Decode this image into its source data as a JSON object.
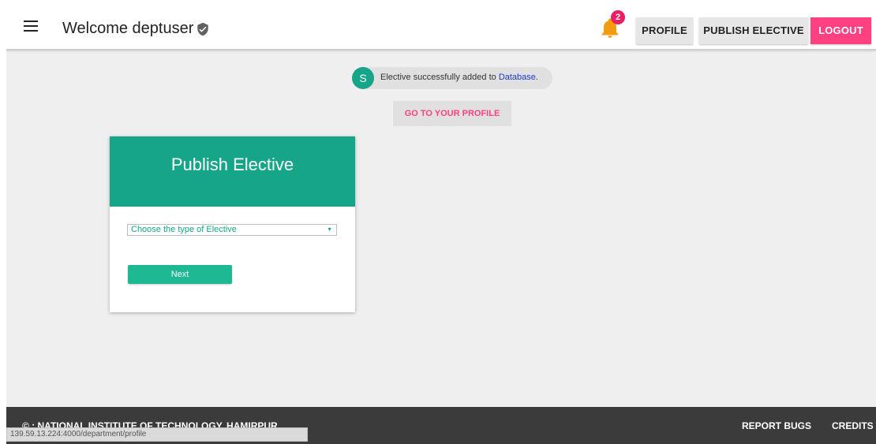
{
  "header": {
    "welcome": "Welcome deptuser",
    "notification_count": "2",
    "nav": {
      "profile": "PROFILE",
      "publish_elective": "PUBLISH ELECTIVE",
      "logout": "LOGOUT"
    }
  },
  "toast": {
    "avatar_letter": "S",
    "message": "Elective successfully added to ",
    "link_text": "Database",
    "message_end": "."
  },
  "goto_profile_label": "GO TO YOUR PROFILE",
  "card": {
    "title": "Publish Elective",
    "select_placeholder": "Choose the type of Elective",
    "next_label": "Next"
  },
  "footer": {
    "copyright": "© : NATIONAL INSTITUTE OF TECHNOLOGY, HAMIRPUR",
    "report_bugs": "REPORT BUGS",
    "credits": "CREDITS"
  },
  "status_bar_url": "139.59.13.224:4000/department/profile",
  "colors": {
    "primary": "#16a589",
    "accent": "#ff4081",
    "footer": "#3b3b3b",
    "link": "#1a3bc4"
  },
  "icons": [
    "menu-icon",
    "verified-shield-icon",
    "bell-icon",
    "dropdown-arrow-icon"
  ]
}
